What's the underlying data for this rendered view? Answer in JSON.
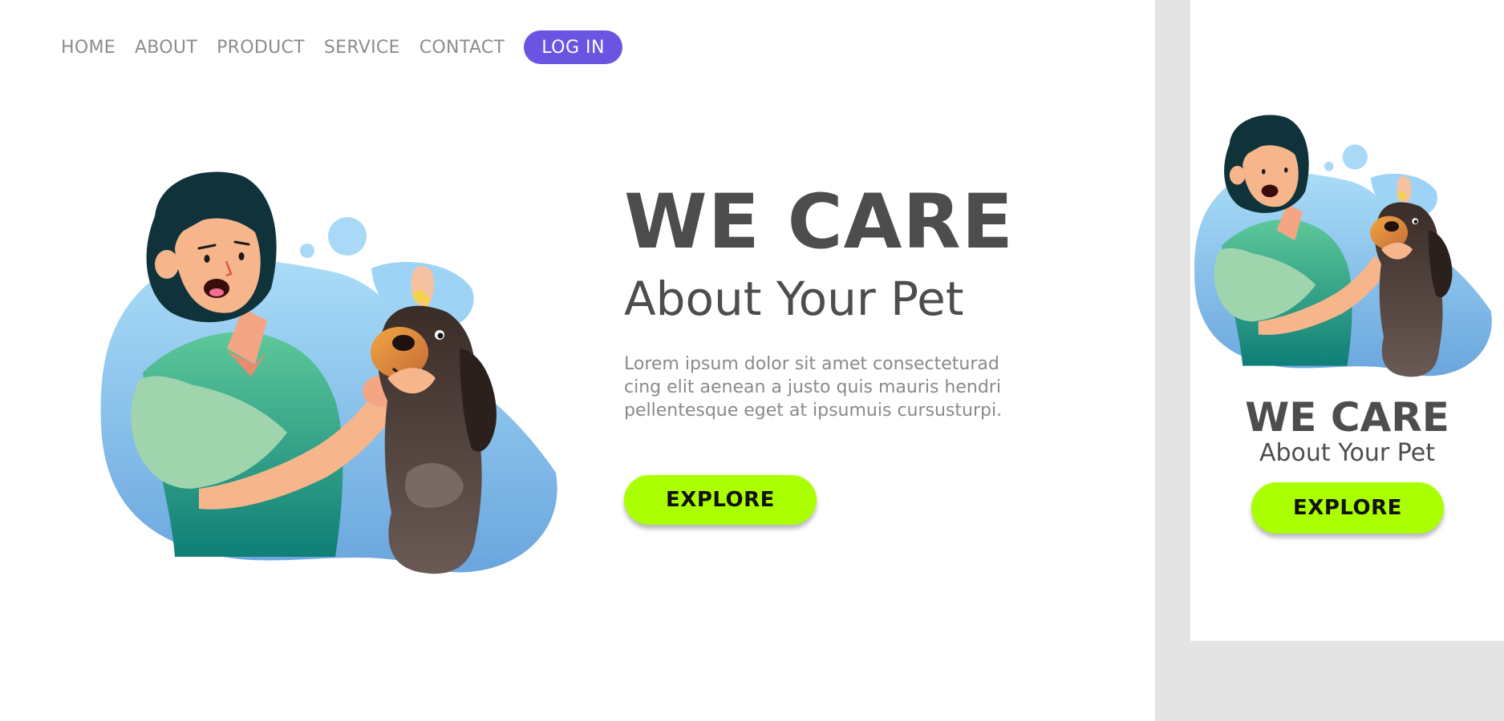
{
  "nav": {
    "items": [
      {
        "label": "HOME"
      },
      {
        "label": "ABOUT"
      },
      {
        "label": "PRODUCT"
      },
      {
        "label": "SERVICE"
      },
      {
        "label": "CONTACT"
      }
    ],
    "login_label": "LOG IN"
  },
  "hero": {
    "title": "WE CARE",
    "subtitle": "About Your Pet",
    "body_lines": [
      "Lorem ipsum dolor sit amet consecteturad",
      "cing elit aenean a justo quis mauris hendri",
      "pellentesque eget at ipsumuis cursusturpi."
    ],
    "cta_label": "EXPLORE"
  },
  "mobile": {
    "title": "WE CARE",
    "subtitle": "About Your Pet",
    "cta_label": "EXPLORE"
  },
  "illustration": {
    "subject_icon": "woman-applying-ear-drops-to-dog-icon"
  },
  "colors": {
    "accent_login": "#6a55e2",
    "cta": "#aaff00",
    "heading": "#4d4d4d",
    "nav_text": "#8c8c8c",
    "blob_blue": "#7fb8e8",
    "shirt_green": "#4fbf8a"
  }
}
